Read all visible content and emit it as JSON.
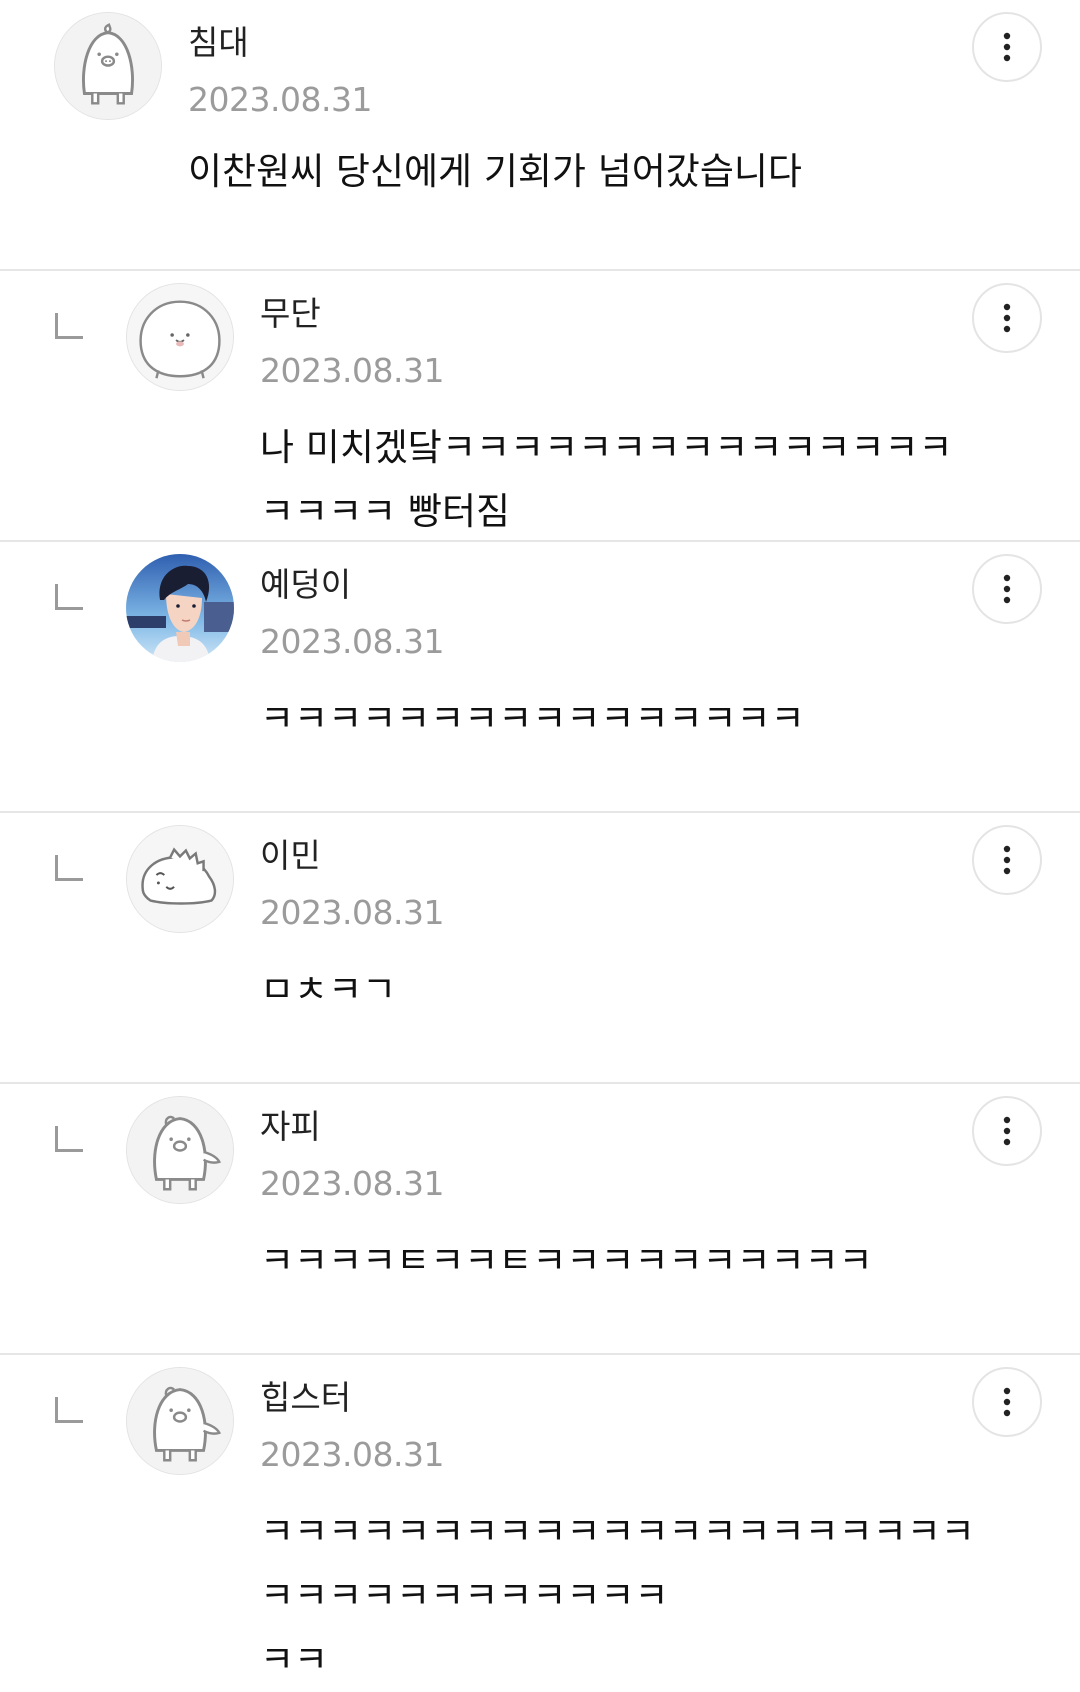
{
  "comments": [
    {
      "is_reply": false,
      "author": "침대",
      "date": "2023.08.31",
      "text": "이찬원씨 당신에게 기회가 넘어갔습니다",
      "avatar_icon": "penguin-avatar-icon"
    },
    {
      "is_reply": true,
      "author": "무단",
      "date": "2023.08.31",
      "text": "나 미치겠닼ㅋㅋㅋㅋㅋㅋㅋㅋㅋㅋㅋㅋㅋㅋㅋㅋㅋㅋㅋ 빵터짐",
      "avatar_icon": "blob-face-avatar-icon"
    },
    {
      "is_reply": true,
      "author": "예덩이",
      "date": "2023.08.31",
      "text": "ㅋㅋㅋㅋㅋㅋㅋㅋㅋㅋㅋㅋㅋㅋㅋㅋ",
      "avatar_icon": "illustrated-person-avatar-icon"
    },
    {
      "is_reply": true,
      "author": "이민",
      "date": "2023.08.31",
      "text": "ㅁㅊㅋㄱ",
      "avatar_icon": "dinosaur-avatar-icon"
    },
    {
      "is_reply": true,
      "author": "자피",
      "date": "2023.08.31",
      "text": "ㅋㅋㅋㅋㅌㅋㅋㅌㅋㅋㅋㅋㅋㅋㅋㅋㅋㅋ",
      "avatar_icon": "penguin-avatar-icon"
    },
    {
      "is_reply": true,
      "author": "힙스터",
      "date": "2023.08.31",
      "text": "ㅋㅋㅋㅋㅋㅋㅋㅋㅋㅋㅋㅋㅋㅋㅋㅋㅋㅋㅋㅋㅋㅋㅋㅋㅋㅋㅋㅋㅋㅋㅋㅋㅋ\nㅋㅋ",
      "avatar_icon": "penguin-avatar-icon"
    }
  ],
  "colors": {
    "divider": "#e6e6e6",
    "date_text": "#9b9b9b",
    "reply_mark": "#9a9a9a"
  }
}
